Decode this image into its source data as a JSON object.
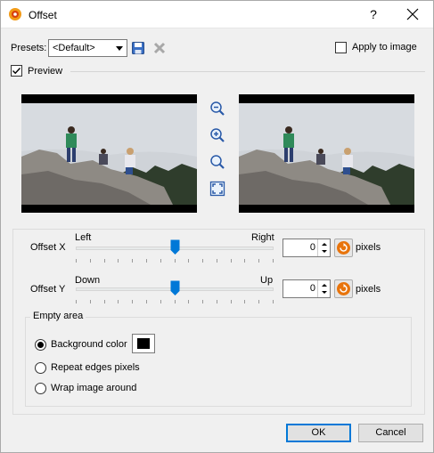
{
  "window": {
    "title": "Offset",
    "help_label": "?"
  },
  "presets": {
    "label": "Presets:",
    "selected": "<Default>"
  },
  "apply_to_image": {
    "label": "Apply to image",
    "checked": false
  },
  "preview": {
    "label": "Preview",
    "checked": true
  },
  "offset_x": {
    "label": "Offset X",
    "min_label": "Left",
    "max_label": "Right",
    "value": "0",
    "unit": "pixels",
    "slider_fraction": 0.5
  },
  "offset_y": {
    "label": "Offset Y",
    "min_label": "Down",
    "max_label": "Up",
    "value": "0",
    "unit": "pixels",
    "slider_fraction": 0.5
  },
  "empty_area": {
    "title": "Empty area",
    "options": [
      {
        "label": "Background color",
        "selected": true
      },
      {
        "label": "Repeat edges pixels",
        "selected": false
      },
      {
        "label": "Wrap image around",
        "selected": false
      }
    ],
    "background_color": "#000000"
  },
  "buttons": {
    "ok": "OK",
    "cancel": "Cancel"
  },
  "colors": {
    "accent": "#0078d7",
    "reset_icon": "#e8740c"
  }
}
